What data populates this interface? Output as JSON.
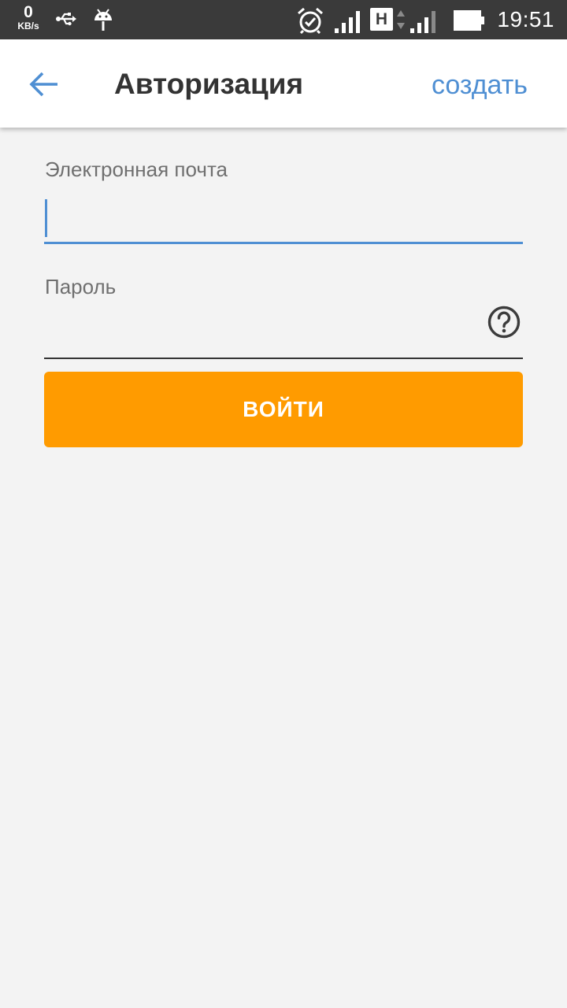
{
  "status_bar": {
    "speed_value": "0",
    "speed_unit": "KB/s",
    "network_type": "H",
    "time": "19:51",
    "icons": [
      "usb-icon",
      "android-debug-icon",
      "alarm-icon",
      "signal-icon",
      "network-h-icon",
      "data-arrows-icon",
      "signal-icon",
      "battery-icon"
    ]
  },
  "app_bar": {
    "back_icon": "arrow-back-icon",
    "title": "Авторизация",
    "create_label": "создать"
  },
  "form": {
    "email": {
      "label": "Электронная почта",
      "value": "",
      "placeholder": ""
    },
    "password": {
      "label": "Пароль",
      "value": "",
      "placeholder": "",
      "help_icon": "question-circle-icon"
    },
    "login_label": "ВОЙТИ"
  },
  "colors": {
    "accent": "#4f8fd3",
    "button": "#ff9b00",
    "status_bar": "#3a3a3a",
    "background": "#f3f3f3"
  }
}
